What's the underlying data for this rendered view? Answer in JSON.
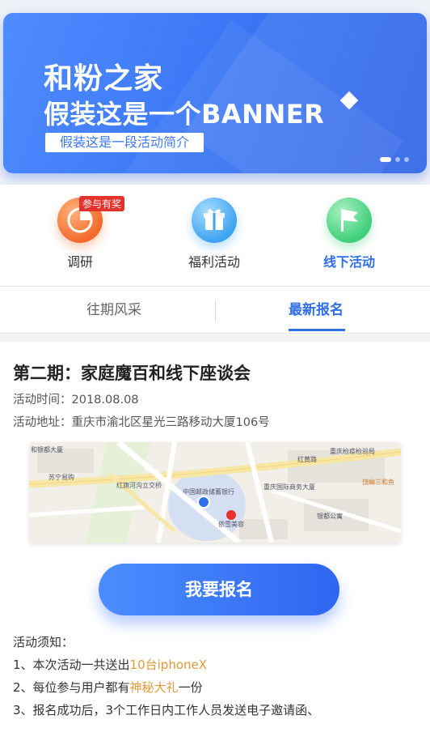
{
  "banner": {
    "title_line1": "和粉之家",
    "title_line2": "假装这是一个BANNER",
    "subtitle": "假装这是一段活动简介",
    "slides": 3,
    "active_slide": 1
  },
  "categories": [
    {
      "label": "调研",
      "icon": "clock-icon",
      "badge": "参与有奖",
      "color": "#f36b2c"
    },
    {
      "label": "福利活动",
      "icon": "gift-icon",
      "color": "#3fa3f0"
    },
    {
      "label": "线下活动",
      "icon": "flag-icon",
      "color": "#3fcf7a",
      "active": true
    }
  ],
  "subtabs": [
    {
      "label": "往期风采"
    },
    {
      "label": "最新报名",
      "active": true
    }
  ],
  "event": {
    "title": "第二期：家庭魔百和线下座谈会",
    "time_label": "活动时间：",
    "time_value": "2018.08.08",
    "address_label": "活动地址：",
    "address_value": "重庆市渝北区星光三路移动大厦106号"
  },
  "map": {
    "labels": [
      "和银都大厦",
      "苏宁易购",
      "红旗河沟立交桥",
      "中国邮政储蓄银行",
      "依雪美容",
      "重庆国际商务大厦",
      "银都公寓",
      "重庆检疫检验局",
      "红黄路",
      "饶幽三和鱼"
    ]
  },
  "cta": {
    "label": "我要报名"
  },
  "notes": {
    "title": "活动须知：",
    "items": [
      {
        "prefix": "1、本次活动一共送出",
        "highlight": "10台iphoneX",
        "suffix": ""
      },
      {
        "prefix": "2、每位参与用户都有",
        "highlight": "神秘大礼",
        "suffix": "一份"
      },
      {
        "prefix": "3、报名成功后，3个工作日内工作人员发送电子邀请函、",
        "highlight": "",
        "suffix": ""
      }
    ]
  },
  "colors": {
    "accent": "#2f6fe8",
    "highlight": "#e09a3a",
    "badge": "#e4322d"
  }
}
